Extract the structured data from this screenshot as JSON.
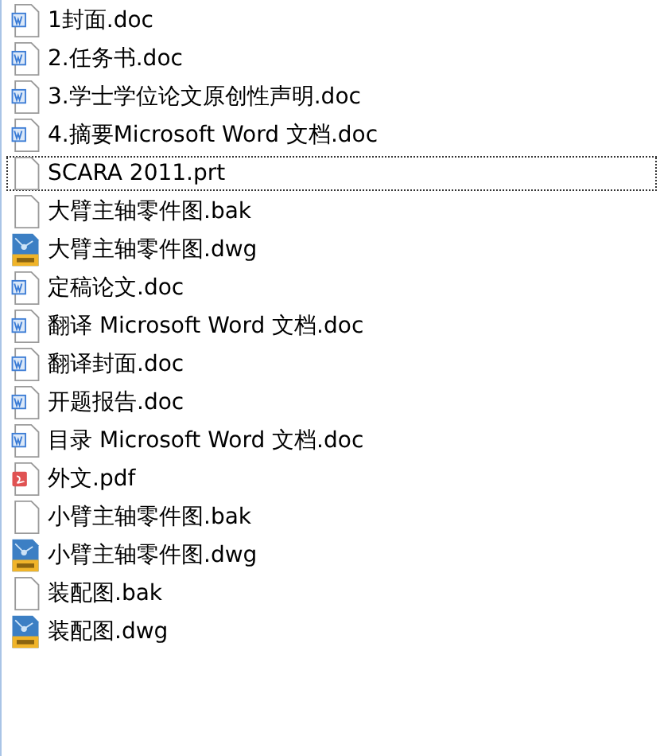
{
  "files": [
    {
      "name": "1封面.doc",
      "kind": "word",
      "focused": false
    },
    {
      "name": "2.任务书.doc",
      "kind": "word",
      "focused": false
    },
    {
      "name": "3.学士学位论文原创性声明.doc",
      "kind": "word",
      "focused": false
    },
    {
      "name": "4.摘要Microsoft Word 文档.doc",
      "kind": "word",
      "focused": false
    },
    {
      "name": "SCARA 2011.prt",
      "kind": "blank",
      "focused": true
    },
    {
      "name": "大臂主轴零件图.bak",
      "kind": "blank",
      "focused": false
    },
    {
      "name": "大臂主轴零件图.dwg",
      "kind": "dwg",
      "focused": false
    },
    {
      "name": "定稿论文.doc",
      "kind": "word",
      "focused": false
    },
    {
      "name": "翻译 Microsoft Word 文档.doc",
      "kind": "word",
      "focused": false
    },
    {
      "name": "翻译封面.doc",
      "kind": "word",
      "focused": false
    },
    {
      "name": "开题报告.doc",
      "kind": "word",
      "focused": false
    },
    {
      "name": "目录 Microsoft Word 文档.doc",
      "kind": "word",
      "focused": false
    },
    {
      "name": "外文.pdf",
      "kind": "pdf",
      "focused": false
    },
    {
      "name": "小臂主轴零件图.bak",
      "kind": "blank",
      "focused": false
    },
    {
      "name": "小臂主轴零件图.dwg",
      "kind": "dwg",
      "focused": false
    },
    {
      "name": "装配图.bak",
      "kind": "blank",
      "focused": false
    },
    {
      "name": "装配图.dwg",
      "kind": "dwg",
      "focused": false
    }
  ]
}
